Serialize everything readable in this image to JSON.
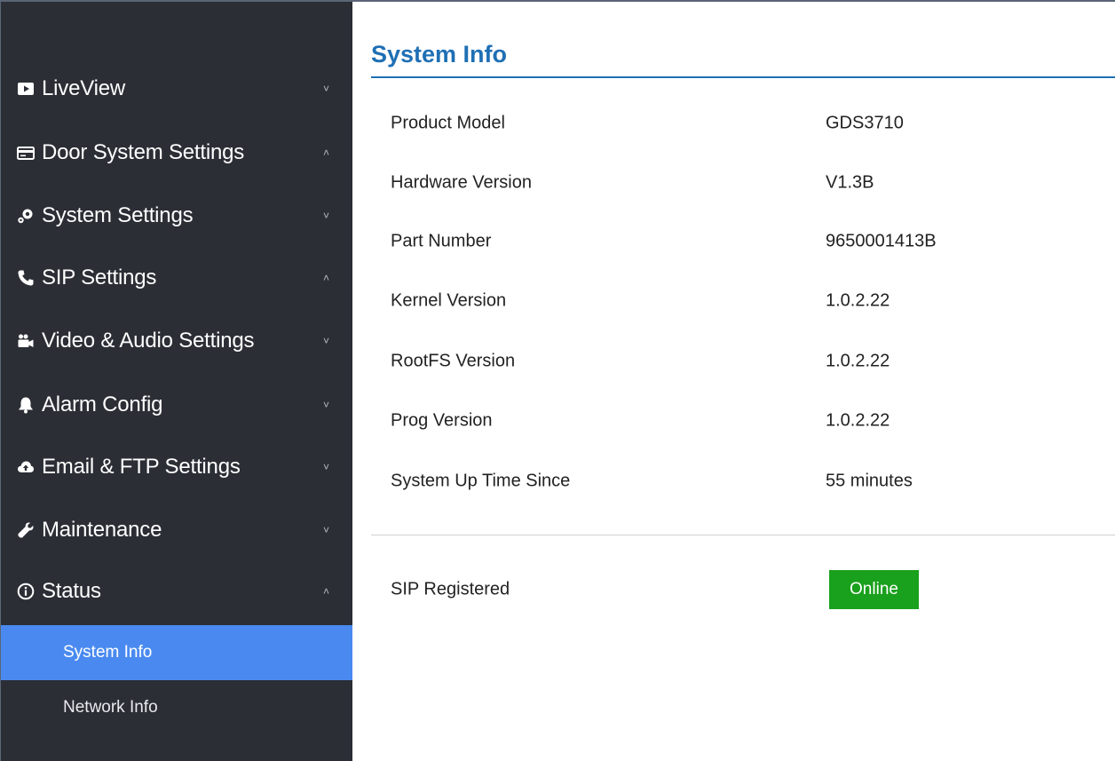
{
  "sidebar": {
    "items": [
      {
        "icon": "video-play-icon",
        "label": "LiveView",
        "chevron": "˅"
      },
      {
        "icon": "card-icon",
        "label": "Door System Settings",
        "chevron": "˄"
      },
      {
        "icon": "gears-icon",
        "label": "System Settings",
        "chevron": "˅"
      },
      {
        "icon": "phone-icon",
        "label": "SIP Settings",
        "chevron": "˄"
      },
      {
        "icon": "video-camera-icon",
        "label": "Video & Audio Settings",
        "chevron": "˅"
      },
      {
        "icon": "bell-icon",
        "label": "Alarm Config",
        "chevron": "˅"
      },
      {
        "icon": "cloud-upload-icon",
        "label": "Email & FTP Settings",
        "chevron": "˅"
      },
      {
        "icon": "wrench-icon",
        "label": "Maintenance",
        "chevron": "˅"
      },
      {
        "icon": "info-circle-icon",
        "label": "Status",
        "chevron": "˄"
      }
    ],
    "sub_items": [
      {
        "label": "System Info",
        "active": true
      },
      {
        "label": "Network Info",
        "active": false
      }
    ]
  },
  "main": {
    "title": "System Info",
    "rows": [
      {
        "key": "Product Model",
        "value": "GDS3710"
      },
      {
        "key": "Hardware Version",
        "value": "V1.3B"
      },
      {
        "key": "Part Number",
        "value": "9650001413B"
      },
      {
        "key": "Kernel Version",
        "value": "1.0.2.22"
      },
      {
        "key": "RootFS Version",
        "value": "1.0.2.22"
      },
      {
        "key": "Prog Version",
        "value": "1.0.2.22"
      },
      {
        "key": "System Up Time Since",
        "value": "55 minutes"
      }
    ],
    "sip": {
      "key": "SIP Registered",
      "status": "Online"
    }
  },
  "colors": {
    "sidebar_bg": "#2b2e35",
    "active_item": "#4a8af0",
    "title_blue": "#1f6fb4",
    "online_green": "#19a01c"
  }
}
